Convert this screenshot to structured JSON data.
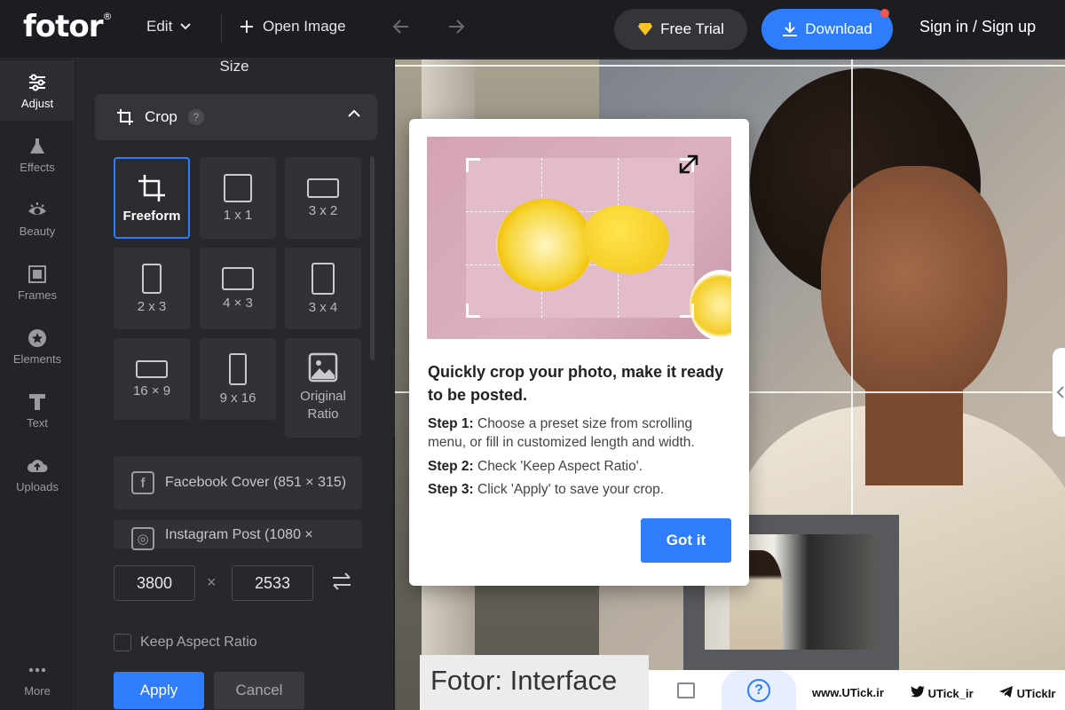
{
  "header": {
    "logo": "fotor",
    "logo_mark": "®",
    "edit_label": "Edit",
    "open_image_label": "Open Image",
    "free_trial_label": "Free Trial",
    "download_label": "Download",
    "signin_label": "Sign in / Sign up"
  },
  "rail": {
    "items": [
      {
        "label": "Adjust",
        "icon": "sliders-icon",
        "active": true
      },
      {
        "label": "Effects",
        "icon": "flask-icon"
      },
      {
        "label": "Beauty",
        "icon": "eye-icon"
      },
      {
        "label": "Frames",
        "icon": "frame-icon"
      },
      {
        "label": "Elements",
        "icon": "star-circle-icon"
      },
      {
        "label": "Text",
        "icon": "text-icon"
      },
      {
        "label": "Uploads",
        "icon": "cloud-upload-icon"
      },
      {
        "label": "More",
        "icon": "more-dots-icon"
      }
    ]
  },
  "panel": {
    "title": "Size",
    "section_label": "Crop",
    "help_glyph": "?",
    "tiles": [
      {
        "label": "Freeform",
        "active": true
      },
      {
        "label": "1 x 1"
      },
      {
        "label": "3 x 2"
      },
      {
        "label": "2 x 3"
      },
      {
        "label": "4 × 3"
      },
      {
        "label": "3 x 4"
      },
      {
        "label": "16 × 9"
      },
      {
        "label": "9 x 16"
      },
      {
        "label": "Original Ratio"
      }
    ],
    "presets": [
      {
        "label": "Facebook Cover (851 × 315)",
        "icon_glyph": "f"
      },
      {
        "label": "Instagram Post (1080 ×",
        "icon_glyph": "◎"
      }
    ],
    "width_value": "3800",
    "height_value": "2533",
    "times_glyph": "×",
    "keep_aspect_label": "Keep Aspect Ratio",
    "apply_label": "Apply",
    "cancel_label": "Cancel"
  },
  "popup": {
    "title": "Quickly crop your photo, make it ready to be posted.",
    "steps": [
      {
        "prefix": "Step 1:",
        "text": " Choose a preset size from scrolling menu, or fill in customized length and width."
      },
      {
        "prefix": "Step 2:",
        "text": " Check 'Keep Aspect Ratio'."
      },
      {
        "prefix": "Step 3:",
        "text": " Click 'Apply' to save your crop."
      }
    ],
    "button_label": "Got it"
  },
  "overlay": {
    "caption": "Fotor: Interface",
    "help_glyph": "?",
    "social_web": "www.UTick.ir",
    "social_twitter": "UTick_ir",
    "social_telegram": "UTickIr"
  },
  "colors": {
    "accent": "#2f7dfc",
    "notification_dot": "#f2574a",
    "free_trial_gem": "#f7c325"
  }
}
